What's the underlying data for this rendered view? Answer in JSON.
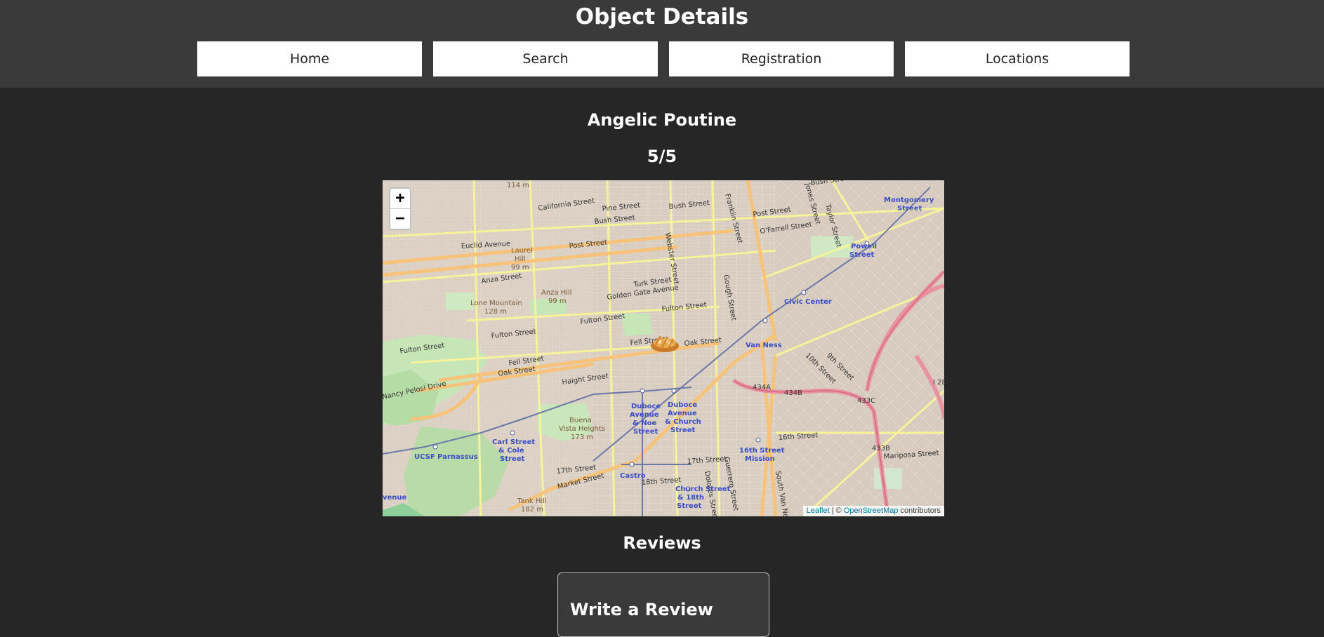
{
  "header": {
    "title": "Object Details",
    "nav": [
      {
        "label": "Home"
      },
      {
        "label": "Search"
      },
      {
        "label": "Registration"
      },
      {
        "label": "Locations"
      }
    ]
  },
  "object": {
    "name": "Angelic Poutine",
    "rating": "5/5"
  },
  "map": {
    "zoom_in": "+",
    "zoom_out": "−",
    "attribution_leaflet": "Leaflet",
    "attribution_sep": " | © ",
    "attribution_osm": "OpenStreetMap",
    "attribution_tail": " contributors",
    "labels": {
      "california": "California Street",
      "pine": "Pine Street",
      "bush1": "Bush Street",
      "bush2": "Bush Street",
      "bush3": "Bush Street",
      "post1": "Post Street",
      "post2": "Post Street",
      "euclid": "Euclid Avenue",
      "laurel": "Laurel",
      "laurel2": "Hill",
      "laurel3": "99 m",
      "ofarrell": "O'Farrell Street",
      "anza": "Anza Street",
      "anzahill": "Anza Hill",
      "anzahill2": "99 m",
      "turk": "Turk Street",
      "golden": "Golden Gate Avenue",
      "lone": "Lone Mountain",
      "lone2": "128 m",
      "fulton1": "Fulton Street",
      "fulton2": "Fulton Street",
      "fulton3": "Fulton Street",
      "fulton4": "Fulton Street",
      "fell1": "Fell Street",
      "fell2": "Fell Street",
      "oak1": "Oak Street",
      "oak2": "Oak Street",
      "haight": "Haight Street",
      "pelosi": "Nancy Pelosi Drive",
      "montgomery": "Montgomery",
      "montgomery2": "Street",
      "powell": "Powell",
      "powell2": "Street",
      "civic": "Civic Center",
      "vanness": "Van Ness",
      "duboce1": "Duboce",
      "duboce1b": "Avenue",
      "duboce1c": "& Noe",
      "duboce1d": "Street",
      "duboce2": "Duboce",
      "duboce2b": "Avenue",
      "duboce2c": "& Church",
      "duboce2d": "Street",
      "buena": "Buena",
      "buena2": "Vista Heights",
      "buena3": "173 m",
      "carl": "Carl Street",
      "carl2": "& Cole",
      "carl3": "Street",
      "ucsf": "UCSF Parnassus",
      "sixteenth_m": "16th Street",
      "sixteenth_m2": "Mission",
      "sixteenth": "16th Street",
      "seventeenth1": "17th Street",
      "seventeenth2": "17th Street",
      "eighteenth": "18th Street",
      "market": "Market Street",
      "castro": "Castro",
      "church": "Church Street",
      "church2": "& 18th",
      "church3": "Street",
      "tank": "Tank Hill",
      "tank2": "182 m",
      "mariposa": "Mariposa Street",
      "tenth": "10th Street",
      "ninth": "9th Street",
      "i434a": "434A",
      "i434b": "434B",
      "i433c": "433C",
      "i433b": "433B",
      "i280": "I 28",
      "franklin": "Franklin Street",
      "webster": "Webster Street",
      "gough": "Gough Street",
      "taylor": "Taylor Street",
      "jones": "Jones Street",
      "guerrero": "Guerrero Street",
      "dolores": "Dolores Street",
      "southvn": "South Van Ness",
      "avenue": "venue",
      "t114": "114 m"
    }
  },
  "reviews": {
    "heading": "Reviews",
    "write_title": "Write a Review"
  }
}
